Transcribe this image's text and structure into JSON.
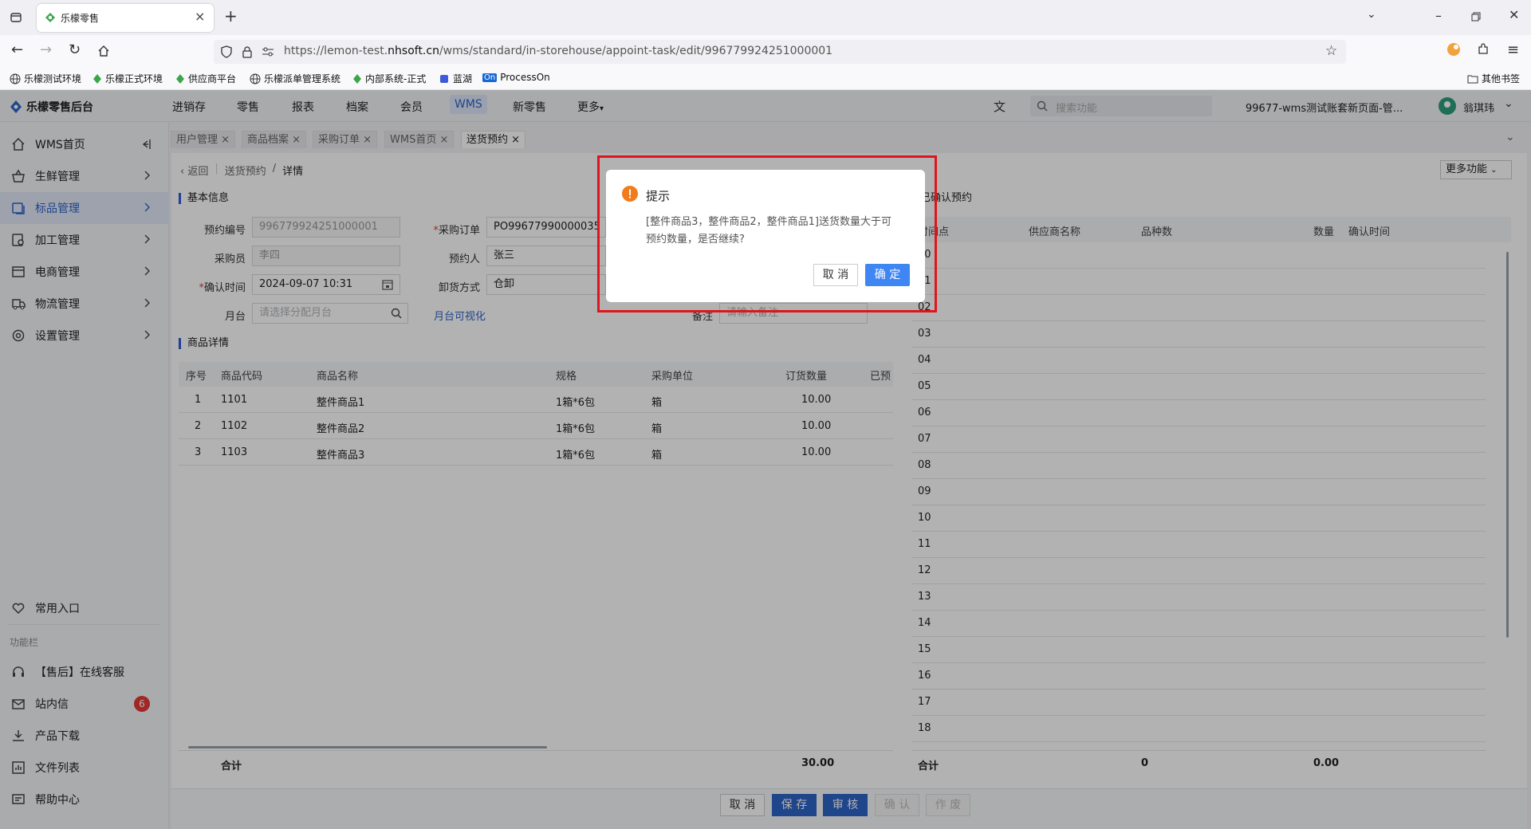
{
  "browser": {
    "tab_title": "乐檬零售",
    "url_prefix": "https://lemon-test.",
    "url_domain": "nhsoft.cn",
    "url_path": "/wms/standard/in-storehouse/appoint-task/edit/996779924251000001",
    "bookmarks": [
      "乐檬测试环境",
      "乐檬正式环境",
      "供应商平台",
      "乐檬派单管理系统",
      "内部系统-正式",
      "蓝湖",
      "ProcessOn"
    ],
    "processon_badge": "On",
    "other_bookmarks": "其他书签"
  },
  "app": {
    "logo_text": "乐檬零售后台",
    "nav": [
      "进销存",
      "零售",
      "报表",
      "档案",
      "会员",
      "WMS",
      "新零售",
      "更多"
    ],
    "active_nav": "WMS",
    "search_placeholder": "搜索功能",
    "store": "99677-wms测试账套新页面-管...",
    "user": "翁琪玮"
  },
  "sidebar": {
    "items": [
      {
        "label": "WMS首页",
        "icon": "home-icon"
      },
      {
        "label": "生鲜管理",
        "icon": "basket-icon"
      },
      {
        "label": "标品管理",
        "icon": "box-icon"
      },
      {
        "label": "加工管理",
        "icon": "factory-icon"
      },
      {
        "label": "电商管理",
        "icon": "shop-icon"
      },
      {
        "label": "物流管理",
        "icon": "truck-icon"
      },
      {
        "label": "设置管理",
        "icon": "gear-icon"
      }
    ],
    "common": "常用入口",
    "section_label": "功能栏",
    "bottom": [
      {
        "label": "【售后】在线客服",
        "icon": "headset-icon"
      },
      {
        "label": "站内信",
        "icon": "mail-icon"
      },
      {
        "label": "产品下载",
        "icon": "download-icon"
      },
      {
        "label": "文件列表",
        "icon": "file-list-icon"
      },
      {
        "label": "帮助中心",
        "icon": "help-icon"
      }
    ],
    "mail_badge": "6"
  },
  "work_tabs": [
    {
      "label": "用户管理",
      "active": false
    },
    {
      "label": "商品档案",
      "active": false
    },
    {
      "label": "采购订单",
      "active": false
    },
    {
      "label": "WMS首页",
      "active": false
    },
    {
      "label": "送货预约",
      "active": true
    }
  ],
  "breadcrumb": {
    "back": "返回",
    "parent": "送货预约",
    "sep": "/",
    "current": "详情"
  },
  "more_functions": "更多功能",
  "basic_info": {
    "title": "基本信息",
    "appoint_no_label": "预约编号",
    "appoint_no": "996779924251000001",
    "po_label": "采购订单",
    "po_value": "PO99677990000035",
    "buyer_label": "采购员",
    "buyer": "李四",
    "booker_label": "预约人",
    "booker": "张三",
    "confirm_time_label": "确认时间",
    "confirm_time": "2024-09-07 10:31",
    "unload_label": "卸货方式",
    "unload": "仓卸",
    "dock_label": "月台",
    "dock_placeholder": "请选择分配月台",
    "dock_visual_link": "月台可视化",
    "remark_label": "备注",
    "remark_placeholder": "请输入备注"
  },
  "goods": {
    "title": "商品详情",
    "headers": [
      "序号",
      "商品代码",
      "商品名称",
      "规格",
      "采购单位",
      "订货数量",
      "已预"
    ],
    "rows": [
      [
        "1",
        "1101",
        "整件商品1",
        "1箱*6包",
        "箱",
        "10.00"
      ],
      [
        "2",
        "1102",
        "整件商品2",
        "1箱*6包",
        "箱",
        "10.00"
      ],
      [
        "3",
        "1103",
        "整件商品3",
        "1箱*6包",
        "箱",
        "10.00"
      ]
    ],
    "total_label": "合计",
    "total_qty": "30.00"
  },
  "confirmed": {
    "title": "已确认预约",
    "headers": [
      "时间点",
      "供应商名称",
      "品种数",
      "数量",
      "确认时间"
    ],
    "hours": [
      "00",
      "01",
      "02",
      "03",
      "04",
      "05",
      "06",
      "07",
      "08",
      "09",
      "10",
      "11",
      "12",
      "13",
      "14",
      "15",
      "16",
      "17",
      "18"
    ],
    "total_label": "合计",
    "total_kinds": "0",
    "total_qty": "0.00"
  },
  "actions": {
    "cancel": "取 消",
    "save": "保 存",
    "audit": "审 核",
    "confirm": "确 认",
    "void": "作 废"
  },
  "dialog": {
    "title": "提示",
    "message_line1": "[整件商品3，整件商品2，整件商品1]送货数量大于可",
    "message_line2": "预约数量，是否继续?",
    "cancel": "取 消",
    "ok": "确 定"
  },
  "colors": {
    "primary": "#2d63c8",
    "warning": "#f27c1c",
    "highlight": "#e0141c",
    "badge": "#e53935"
  }
}
